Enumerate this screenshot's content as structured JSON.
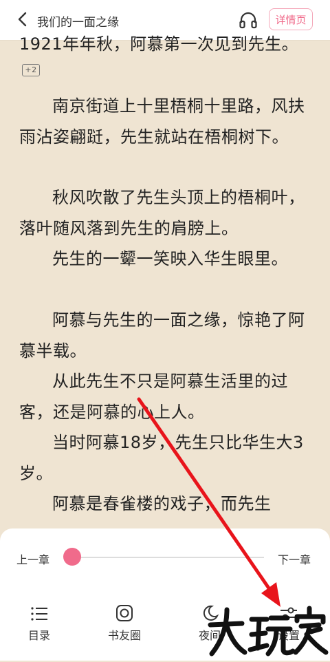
{
  "header": {
    "title": "我们的一面之缘",
    "detail_label": "详情页"
  },
  "content": {
    "paragraphs": [
      {
        "text": "1921年年秋，阿慕第一次见到先生。",
        "badge": "+2"
      },
      {
        "text": "南京街道上十里梧桐十里路，风扶雨沾姿翩跹，先生就站在梧桐树下。"
      },
      {
        "text": "秋风吹散了先生头顶上的梧桐叶，落叶随风落到先生的肩膀上。"
      },
      {
        "text": "先生的一颦一笑映入华生眼里。"
      },
      {
        "text": "阿慕与先生的一面之缘，惊艳了阿慕半载。"
      },
      {
        "text": "从此先生不只是阿慕生活里的过客，还是阿慕的心上人。"
      },
      {
        "text": "当时阿慕18岁，先生只比华生大3岁。"
      },
      {
        "text": "阿慕是春雀楼的戏子，而先生"
      }
    ]
  },
  "panel": {
    "prev_chapter": "上一章",
    "next_chapter": "下一章",
    "progress": 0.0,
    "menu": [
      {
        "label": "目录",
        "icon": "list-icon"
      },
      {
        "label": "书友圈",
        "icon": "circle-icon"
      },
      {
        "label": "夜间",
        "icon": "moon-icon"
      },
      {
        "label": "设置",
        "icon": "settings-icon"
      }
    ]
  },
  "watermark": {
    "text": "大玩家"
  },
  "colors": {
    "accent": "#f06b8b",
    "background": "#efe4d2",
    "arrow": "#e8141b"
  }
}
